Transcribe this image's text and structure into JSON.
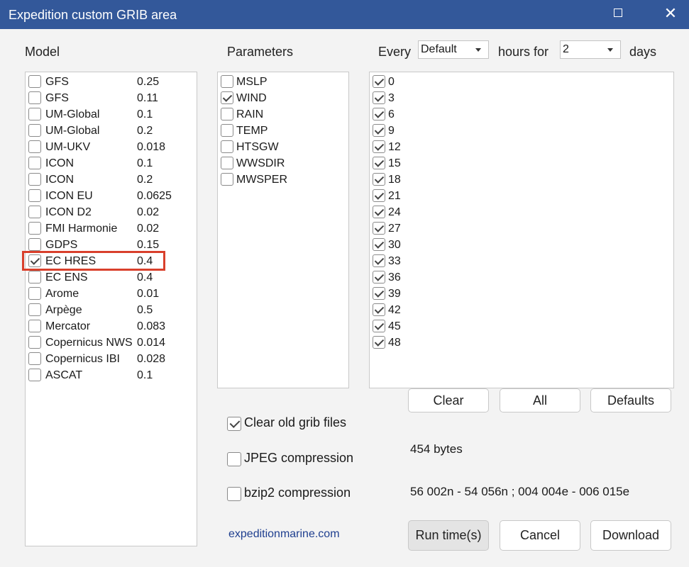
{
  "window": {
    "title": "Expedition custom GRIB area",
    "maximize_icon": "maximize-icon",
    "close_glyph": "✕"
  },
  "model": {
    "heading": "Model",
    "items": [
      {
        "name": "GFS",
        "resolution": "0.25",
        "checked": false
      },
      {
        "name": "GFS",
        "resolution": "0.11",
        "checked": false
      },
      {
        "name": "UM-Global",
        "resolution": "0.1",
        "checked": false
      },
      {
        "name": "UM-Global",
        "resolution": "0.2",
        "checked": false
      },
      {
        "name": "UM-UKV",
        "resolution": "0.018",
        "checked": false
      },
      {
        "name": "ICON",
        "resolution": "0.1",
        "checked": false
      },
      {
        "name": "ICON",
        "resolution": "0.2",
        "checked": false
      },
      {
        "name": "ICON EU",
        "resolution": "0.0625",
        "checked": false
      },
      {
        "name": "ICON D2",
        "resolution": "0.02",
        "checked": false
      },
      {
        "name": "FMI Harmonie",
        "resolution": "0.02",
        "checked": false
      },
      {
        "name": "GDPS",
        "resolution": "0.15",
        "checked": false
      },
      {
        "name": "EC HRES",
        "resolution": "0.4",
        "checked": true
      },
      {
        "name": "EC ENS",
        "resolution": "0.4",
        "checked": false
      },
      {
        "name": "Arome",
        "resolution": "0.01",
        "checked": false
      },
      {
        "name": "Arpège",
        "resolution": "0.5",
        "checked": false
      },
      {
        "name": "Mercator",
        "resolution": "0.083",
        "checked": false
      },
      {
        "name": "Copernicus NWS",
        "resolution": "0.014",
        "checked": false
      },
      {
        "name": "Copernicus IBI",
        "resolution": "0.028",
        "checked": false
      },
      {
        "name": "ASCAT",
        "resolution": "0.1",
        "checked": false
      }
    ]
  },
  "parameters": {
    "heading": "Parameters",
    "items": [
      {
        "name": "MSLP",
        "checked": false
      },
      {
        "name": "WIND",
        "checked": true
      },
      {
        "name": "RAIN",
        "checked": false
      },
      {
        "name": "TEMP",
        "checked": false
      },
      {
        "name": "HTSGW",
        "checked": false
      },
      {
        "name": "WWSDIR",
        "checked": false
      },
      {
        "name": "MWSPER",
        "checked": false
      }
    ]
  },
  "timing": {
    "every_label": "Every",
    "every_value": "Default",
    "hours_label": "hours for",
    "days_value": "2",
    "days_label": "days",
    "hours": [
      {
        "value": "0",
        "checked": true
      },
      {
        "value": "3",
        "checked": true
      },
      {
        "value": "6",
        "checked": true
      },
      {
        "value": "9",
        "checked": true
      },
      {
        "value": "12",
        "checked": true
      },
      {
        "value": "15",
        "checked": true
      },
      {
        "value": "18",
        "checked": true
      },
      {
        "value": "21",
        "checked": true
      },
      {
        "value": "24",
        "checked": true
      },
      {
        "value": "27",
        "checked": true
      },
      {
        "value": "30",
        "checked": true
      },
      {
        "value": "33",
        "checked": true
      },
      {
        "value": "36",
        "checked": true
      },
      {
        "value": "39",
        "checked": true
      },
      {
        "value": "42",
        "checked": true
      },
      {
        "value": "45",
        "checked": true
      },
      {
        "value": "48",
        "checked": true
      }
    ]
  },
  "buttons": {
    "clear": "Clear",
    "all": "All",
    "defaults": "Defaults",
    "run_times": "Run time(s)",
    "cancel": "Cancel",
    "download": "Download"
  },
  "options": {
    "clear_old": {
      "label": "Clear old grib files",
      "checked": true
    },
    "jpeg": {
      "label": "JPEG compression",
      "checked": false
    },
    "bzip2": {
      "label": "bzip2 compression",
      "checked": false
    }
  },
  "info": {
    "size": "454 bytes",
    "area": "56 002n - 54 056n ; 004 004e - 006 015e"
  },
  "footer": {
    "link": "expeditionmarine.com"
  }
}
